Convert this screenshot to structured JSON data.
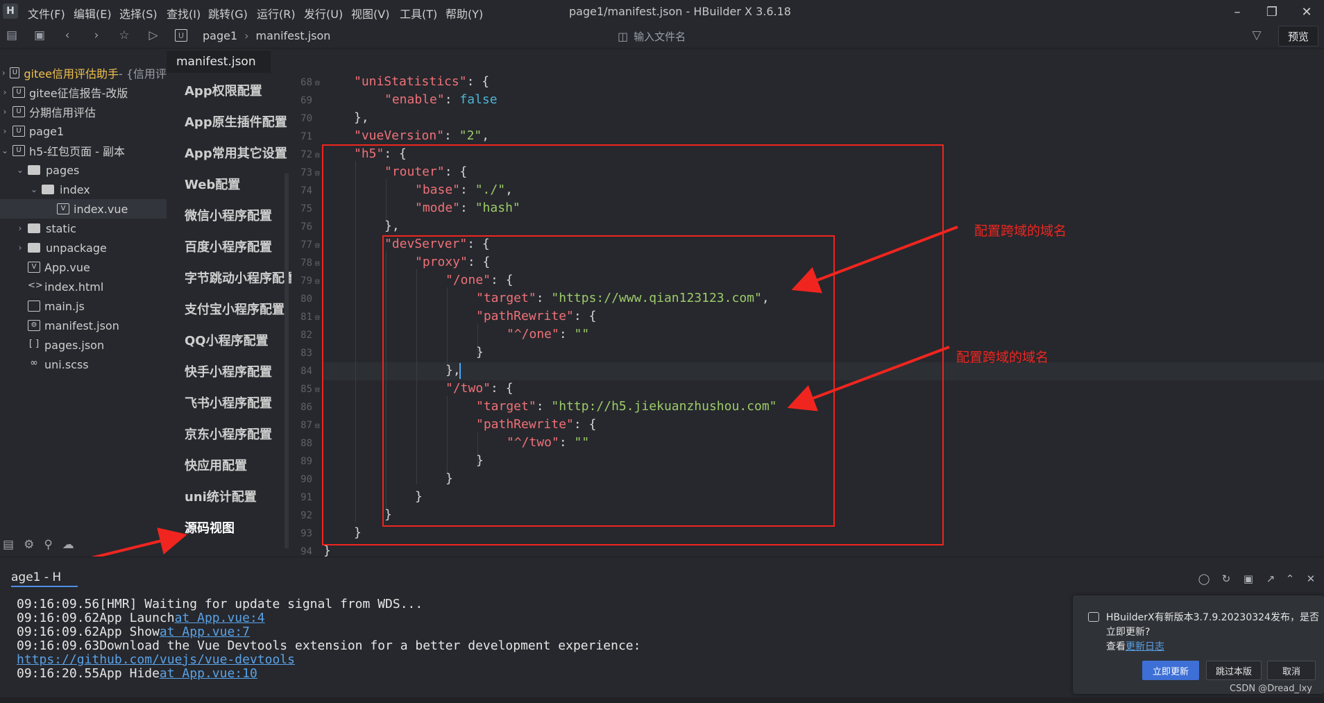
{
  "app": {
    "logo_letter": "H",
    "menu": [
      "文件(F)",
      "编辑(E)",
      "选择(S)",
      "查找(I)",
      "跳转(G)",
      "运行(R)",
      "发行(U)",
      "视图(V)",
      "工具(T)",
      "帮助(Y)"
    ],
    "window_title": "page1/manifest.json - HBuilder X 3.6.18"
  },
  "toolbar": {
    "breadcrumb": [
      "page1",
      "manifest.json"
    ],
    "file_search_placeholder": "输入文件名",
    "preview_label": "预览"
  },
  "sidebar": {
    "items": [
      {
        "label": "gitee信用评估助手",
        "suffix": " - {信用评",
        "type": "project"
      },
      {
        "label": "gitee征信报告-改版",
        "type": "project"
      },
      {
        "label": "分期信用评估",
        "type": "project"
      },
      {
        "label": "page1",
        "type": "project"
      },
      {
        "label": "h5-红包页面 - 副本",
        "type": "project"
      },
      {
        "label": "pages",
        "type": "folder"
      },
      {
        "label": "index",
        "type": "folder"
      },
      {
        "label": "index.vue",
        "type": "file"
      },
      {
        "label": "static",
        "type": "folder"
      },
      {
        "label": "unpackage",
        "type": "folder"
      },
      {
        "label": "App.vue",
        "type": "file"
      },
      {
        "label": "index.html",
        "type": "file"
      },
      {
        "label": "main.js",
        "type": "file"
      },
      {
        "label": "manifest.json",
        "type": "file"
      },
      {
        "label": "pages.json",
        "type": "file"
      },
      {
        "label": "uni.scss",
        "type": "file"
      }
    ]
  },
  "editor": {
    "tab_label": "manifest.json",
    "config_nav": [
      "App权限配置",
      "App原生插件配置",
      "App常用其它设置",
      "Web配置",
      "微信小程序配置",
      "百度小程序配置",
      "字节跳动小程序配置",
      "支付宝小程序配置",
      "QQ小程序配置",
      "快手小程序配置",
      "飞书小程序配置",
      "京东小程序配置",
      "快应用配置",
      "uni统计配置",
      "源码视图"
    ],
    "active_config": "源码视图",
    "line_numbers": [
      "68",
      "69",
      "70",
      "71",
      "72",
      "73",
      "74",
      "75",
      "76",
      "77",
      "78",
      "79",
      "80",
      "81",
      "82",
      "83",
      "84",
      "85",
      "86",
      "87",
      "88",
      "89",
      "90",
      "91",
      "92",
      "93",
      "94"
    ]
  },
  "annotations": {
    "label_1": "配置跨域的域名",
    "label_2": "配置跨域的域名"
  },
  "console": {
    "tab_label": "age1 - H",
    "lines": [
      {
        "time": "09:16:09.56",
        "text": "[HMR] Waiting for update signal from WDS..."
      },
      {
        "time": "09:16:09.62",
        "text": "App Launch",
        "link": "at App.vue:4"
      },
      {
        "time": "09:16:09.62",
        "text": "App Show",
        "link": "at App.vue:7"
      },
      {
        "time": "09:16:09.63",
        "text": "Download the Vue Devtools extension for a better development experience:"
      },
      {
        "time": "",
        "text": "",
        "link": "https://github.com/vuejs/vue-devtools"
      },
      {
        "time": "09:16:20.55",
        "text": "App Hide",
        "link": "at App.vue:10"
      }
    ]
  },
  "notification": {
    "message": "HBuilderX有新版本3.7.9.20230324发布，是否立即更新?",
    "changelog_prefix": "查看",
    "changelog_link": "更新日志",
    "update_now": "立即更新",
    "skip": "跳过本版",
    "cancel": "取消"
  },
  "watermark": "CSDN @Dread_lxy",
  "colors": {
    "accent": "#4f8fe8",
    "annotation": "#f0251f",
    "key": "#f07178",
    "string": "#9ecb6a",
    "boolean": "#4fb5d8"
  }
}
